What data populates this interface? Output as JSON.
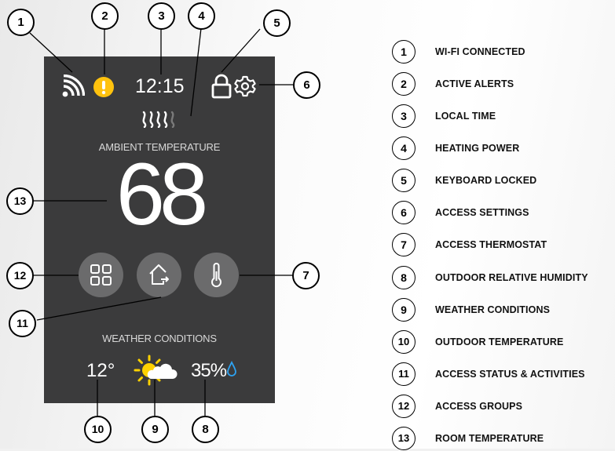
{
  "device": {
    "time": "12:15",
    "ambient_label": "AMBIENT TEMPERATURE",
    "room_temperature": "68",
    "weather_label": "WEATHER CONDITIONS",
    "outdoor_temperature": "12°",
    "outdoor_humidity": "35%",
    "heating_power_level": {
      "active_bars": 4,
      "total_bars": 5
    },
    "icons": {
      "wifi": "wifi-icon",
      "alert": "alert-icon",
      "heating": "heating-power-icon",
      "lock": "lock-icon",
      "settings": "gear-icon",
      "groups": "grid-icon",
      "status": "home-exit-icon",
      "thermostat": "thermometer-icon",
      "weather": "sun-cloud-icon",
      "humidity": "droplet-icon"
    },
    "colors": {
      "screen_background": "#3b3b3c",
      "button_background": "#6b6b6c",
      "alert": "#ffc20e",
      "sun": "#ffd200",
      "humidity_drop": "#2ea3f2"
    }
  },
  "callouts": {
    "c1": "1",
    "c2": "2",
    "c3": "3",
    "c4": "4",
    "c5": "5",
    "c6": "6",
    "c7": "7",
    "c8": "8",
    "c9": "9",
    "c10": "10",
    "c11": "11",
    "c12": "12",
    "c13": "13"
  },
  "legend": [
    {
      "num": "1",
      "label": "WI-FI CONNECTED"
    },
    {
      "num": "2",
      "label": "ACTIVE ALERTS"
    },
    {
      "num": "3",
      "label": "LOCAL TIME"
    },
    {
      "num": "4",
      "label": "HEATING POWER"
    },
    {
      "num": "5",
      "label": "KEYBOARD LOCKED"
    },
    {
      "num": "6",
      "label": "ACCESS SETTINGS"
    },
    {
      "num": "7",
      "label": "ACCESS THERMOSTAT"
    },
    {
      "num": "8",
      "label": "OUTDOOR RELATIVE HUMIDITY"
    },
    {
      "num": "9",
      "label": "WEATHER CONDITIONS"
    },
    {
      "num": "10",
      "label": "OUTDOOR TEMPERATURE"
    },
    {
      "num": "11",
      "label": "ACCESS STATUS & ACTIVITIES"
    },
    {
      "num": "12",
      "label": "ACCESS GROUPS"
    },
    {
      "num": "13",
      "label": "ROOM TEMPERATURE"
    }
  ]
}
